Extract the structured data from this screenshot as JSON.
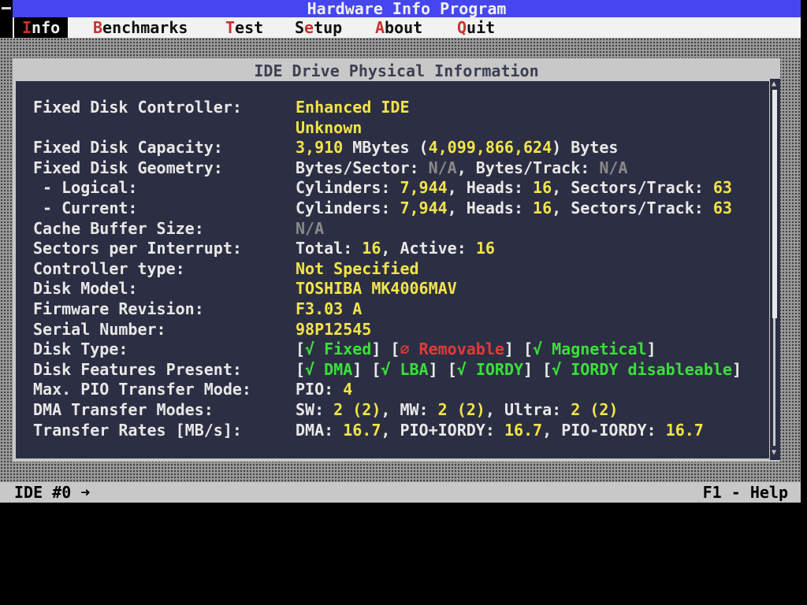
{
  "title": "Hardware Info Program",
  "menu": {
    "info_hk": "I",
    "info_rest": "nfo",
    "bench_hk": "B",
    "bench_rest": "enchmarks",
    "test_hk": "T",
    "test_rest": "est",
    "setup_pre": "S",
    "setup_hk": "e",
    "setup_rest": "tup",
    "about_hk": "A",
    "about_rest": "bout",
    "quit_hk": "Q",
    "quit_rest": "uit"
  },
  "window": {
    "title": "IDE Drive Physical Information"
  },
  "info": {
    "controller_label": "Fixed Disk Controller:",
    "controller_value": "Enhanced IDE",
    "controller_value2": "Unknown",
    "capacity_label": "Fixed Disk Capacity:",
    "capacity_mb": "3,910",
    "capacity_mid": " MBytes (",
    "capacity_bytes": "4,099,866,624",
    "capacity_end": ") Bytes",
    "geometry_label": "Fixed Disk Geometry:",
    "geo_bps_label": "Bytes/Sector: ",
    "geo_bps": "N/A",
    "geo_bpt_label": ", Bytes/Track: ",
    "geo_bpt": "N/A",
    "logical_label": " - Logical:",
    "current_label": " - Current:",
    "cyl_label": "Cylinders: ",
    "heads_label": ", Heads: ",
    "spt_label": ", Sectors/Track: ",
    "logical_cyl": "7,944",
    "logical_heads": "16",
    "logical_spt": "63",
    "current_cyl": "7,944",
    "current_heads": "16",
    "current_spt": "63",
    "cache_label": "Cache Buffer Size:",
    "cache_value": "N/A",
    "spi_label": "Sectors per Interrupt:",
    "spi_total_label": "Total: ",
    "spi_total": "16",
    "spi_active_label": ", Active: ",
    "spi_active": "16",
    "ctrl_type_label": "Controller type:",
    "ctrl_type_value": "Not Specified",
    "model_label": "Disk Model:",
    "model_value": "TOSHIBA MK4006MAV",
    "firmware_label": "Firmware Revision:",
    "firmware_value": "F3.03 A",
    "serial_label": "Serial Number:",
    "serial_value": "98P12545",
    "disk_type_label": "Disk Type:",
    "type_fixed": "√ Fixed",
    "type_removable": "∅ Removable",
    "type_magnetical": "√ Magnetical",
    "features_label": "Disk Features Present:",
    "feat_dma": "√ DMA",
    "feat_lba": "√ LBA",
    "feat_iordy": "√ IORDY",
    "feat_iordy_dis": "√ IORDY disableable",
    "pio_label": "Max. PIO Transfer Mode:",
    "pio_prefix": "PIO: ",
    "pio_value": "4",
    "dma_modes_label": "DMA Transfer Modes:",
    "sw_label": "SW: ",
    "sw_value": "2 (2)",
    "mw_label": ", MW: ",
    "mw_value": "2 (2)",
    "ultra_label": ", Ultra: ",
    "ultra_value": "2 (2)",
    "rates_label": "Transfer Rates [MB/s]:",
    "rate_dma_label": "DMA: ",
    "rate_dma": "16.7",
    "rate_pio_iordy_label": ", PIO+IORDY: ",
    "rate_pio_iordy": "16.7",
    "rate_pio_noiordy_label": ", PIO-IORDY: ",
    "rate_pio_noiordy": "16.7"
  },
  "status": {
    "left": "IDE #0 ➜",
    "right": "F1 - Help"
  }
}
